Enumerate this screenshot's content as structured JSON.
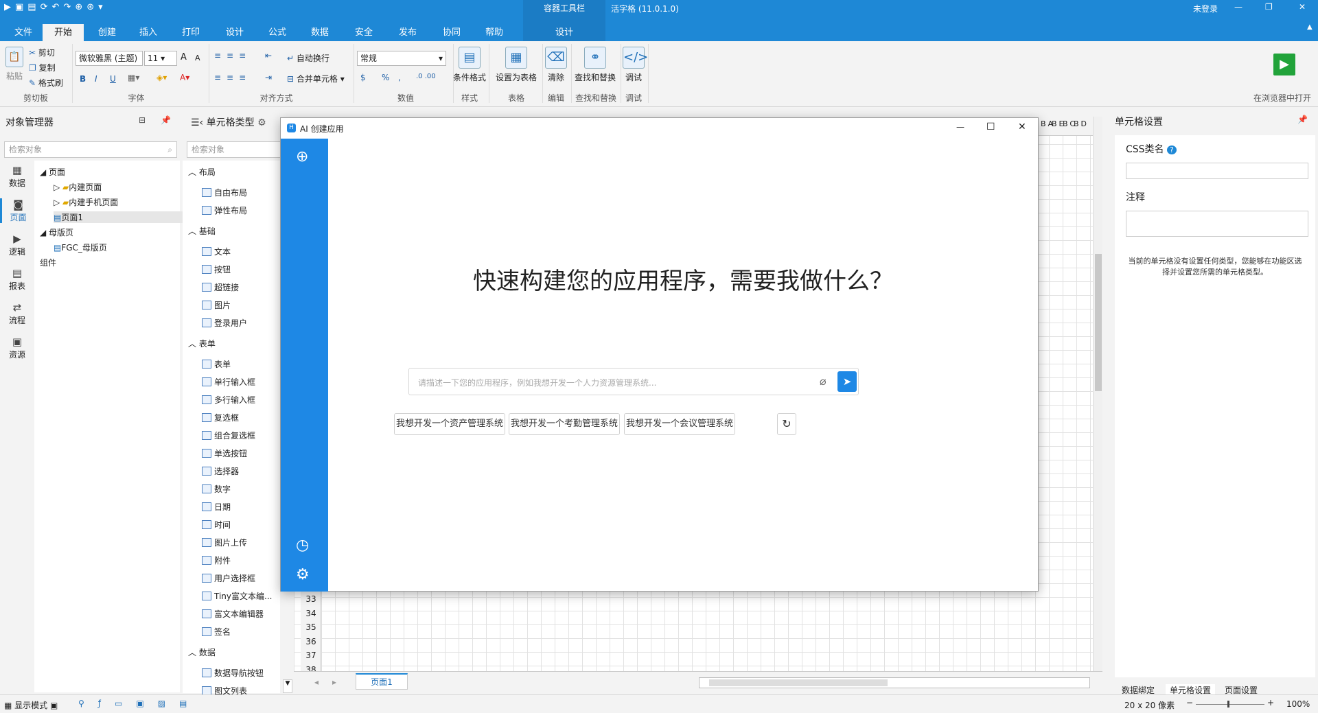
{
  "app": {
    "quick_icons": [
      "▶",
      "▣",
      "▤",
      "⟳",
      "↶",
      "↷",
      "⊕",
      "⊛",
      "▾"
    ],
    "context_title": "容器工具栏",
    "app_title": "活字格 (11.0.1.0)",
    "login": "未登录",
    "win_min": "—",
    "win_max": "❐",
    "win_close": "✕",
    "right_arrow": "▲"
  },
  "tabs": [
    "文件",
    "开始",
    "创建",
    "插入",
    "打印",
    "设计",
    "公式",
    "数据",
    "安全",
    "发布",
    "协同",
    "帮助",
    "设计"
  ],
  "ribbon": {
    "clipboard": {
      "paste": "粘贴",
      "cut": "剪切",
      "copy": "复制",
      "format_painter": "格式刷",
      "group": "剪切板"
    },
    "font": {
      "family": "微软雅黑 (主题)",
      "size": "11",
      "grow": "A",
      "shrink": "A",
      "bold": "B",
      "italic": "I",
      "underline": "U",
      "group": "字体"
    },
    "align": {
      "wrap": "自动换行",
      "merge": "合并单元格",
      "group": "对齐方式"
    },
    "number": {
      "format": "常规",
      "currency": "$",
      "percent": "%",
      "comma": ",",
      "group": "数值"
    },
    "style": {
      "cond": "条件格式",
      "group": "样式"
    },
    "table": {
      "set": "设置为表格",
      "group": "表格"
    },
    "edit": {
      "clear": "清除",
      "group": "编辑"
    },
    "find": {
      "label": "查找和替换",
      "group": "查找和替换"
    },
    "debug": {
      "label": "调试",
      "group": "调试"
    },
    "run": {
      "label": "在浏览器中打开"
    }
  },
  "object_manager": {
    "title": "对象管理器",
    "search": "检索对象",
    "tree": [
      {
        "label": "页面",
        "level": 0
      },
      {
        "label": "内建页面",
        "level": 1
      },
      {
        "label": "内建手机页面",
        "level": 1
      },
      {
        "label": "页面1",
        "level": 1
      },
      {
        "label": "母版页",
        "level": 0
      },
      {
        "label": "FGC_母版页",
        "level": 1
      },
      {
        "label": "组件",
        "level": 0
      }
    ]
  },
  "sidenav": [
    {
      "icon": "▦",
      "label": "数据"
    },
    {
      "icon": "◙",
      "label": "页面"
    },
    {
      "icon": "▶",
      "label": "逻辑"
    },
    {
      "icon": "▤",
      "label": "报表"
    },
    {
      "icon": "⇄",
      "label": "流程"
    },
    {
      "icon": "▣",
      "label": "资源"
    }
  ],
  "celltypes": {
    "title": "单元格类型",
    "search": "检索对象",
    "categories": [
      {
        "name": "布局",
        "items": [
          "自由布局",
          "弹性布局"
        ]
      },
      {
        "name": "基础",
        "items": [
          "文本",
          "按钮",
          "超链接",
          "图片",
          "登录用户"
        ]
      },
      {
        "name": "表单",
        "items": [
          "表单",
          "单行输入框",
          "多行输入框",
          "复选框",
          "组合复选框",
          "单选按钮",
          "选择器",
          "数字",
          "日期",
          "时间",
          "图片上传",
          "附件",
          "用户选择框",
          "Tiny富文本编...",
          "富文本编辑器",
          "签名"
        ]
      },
      {
        "name": "数据",
        "items": [
          "数据导航按钮",
          "图文列表"
        ]
      }
    ]
  },
  "grid": {
    "col_headers": [
      "BA",
      "BE",
      "BC",
      "BD"
    ],
    "row_numbers": [
      "33",
      "34",
      "35",
      "36",
      "37",
      "38"
    ],
    "sheet_tab": "页面1",
    "nav_prev": "◂",
    "nav_next": "▸"
  },
  "cell_settings": {
    "title": "单元格设置",
    "css_label": "CSS类名",
    "note_label": "注释",
    "info": "当前的单元格没有设置任何类型，您能够在功能区选择并设置您所需的单元格类型。",
    "tabs": [
      "数据绑定",
      "单元格设置",
      "页面设置"
    ]
  },
  "dialog": {
    "title": "AI 创建应用",
    "headline": "快速构建您的应用程序，需要我做什么？",
    "placeholder": "请描述一下您的应用程序，例如我想开发一个人力资源管理系统...",
    "suggestions": [
      "我想开发一个资产管理系统",
      "我想开发一个考勤管理系统",
      "我想开发一个会议管理系统"
    ],
    "win_min": "—",
    "win_max": "☐",
    "win_close": "✕",
    "new_icon": "⊕",
    "history_icon": "◷",
    "settings_icon": "⚙",
    "attach_icon": "⌀",
    "send_icon": "➤",
    "refresh_icon": "↻"
  },
  "status": {
    "mode": "显示模式",
    "zoom_size": "20 x 20 像素",
    "zoom": "100%",
    "minus": "−",
    "plus": "+"
  }
}
